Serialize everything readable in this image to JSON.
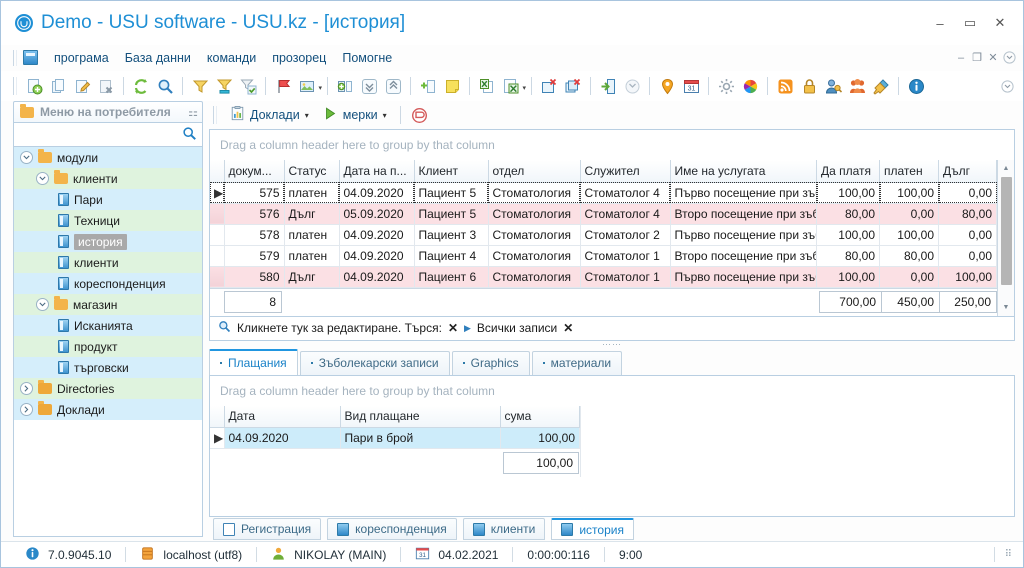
{
  "window": {
    "title": "Demo - USU software - USU.kz - [история]",
    "app_icon": "usu-logo-icon",
    "minimize": "–",
    "maximize": "▭",
    "close": "✕",
    "inner_minimize": "–",
    "inner_restore": "❐",
    "inner_close": "✕"
  },
  "menubar": {
    "items": [
      "програма",
      "База данни",
      "команди",
      "прозорец",
      "Помогне"
    ]
  },
  "toolbar": {
    "groups": [
      [
        "new-record-icon",
        "copy-record-icon",
        "edit-record-icon",
        "delete-record-icon"
      ],
      [
        "refresh-icon",
        "search-icon"
      ],
      [
        "filter-icon",
        "filter-builder-icon",
        "filter-apply-icon"
      ],
      [
        "flag-icon",
        "image-icon"
      ],
      [
        "expand-columns-icon",
        "collapse-all-icon",
        "expand-all-icon"
      ],
      [
        "add-column-icon",
        "note-icon"
      ],
      [
        "export-excel-icon",
        "import-excel-icon"
      ],
      [
        "new-window-icon",
        "close-window-icon"
      ],
      [
        "exit-icon",
        "minimize-window-icon"
      ],
      [
        "map-icon",
        "calendar-icon"
      ],
      [
        "settings-icon",
        "theme-icon"
      ],
      [
        "rss-icon",
        "lock-icon",
        "user-rights-icon",
        "users-icon",
        "plugin-icon"
      ],
      [
        "about-icon"
      ]
    ]
  },
  "sidebar": {
    "header": {
      "label": "Меню на потребителя",
      "folder_icon": "folder-icon",
      "pin_icon": "pin-icon"
    },
    "search": {
      "placeholder": "",
      "value": "",
      "icon": "search-icon"
    },
    "tree": [
      {
        "label": "модули",
        "level": 0,
        "type": "folder",
        "expanded": true,
        "stripe": "blue",
        "selected": false
      },
      {
        "label": "клиенти",
        "level": 1,
        "type": "folder",
        "expanded": true,
        "stripe": "green",
        "selected": false
      },
      {
        "label": "Пари",
        "level": 2,
        "type": "book",
        "expanded": null,
        "stripe": "blue",
        "selected": false
      },
      {
        "label": "Техници",
        "level": 2,
        "type": "book",
        "expanded": null,
        "stripe": "green",
        "selected": false
      },
      {
        "label": "история",
        "level": 2,
        "type": "book",
        "expanded": null,
        "stripe": "blue",
        "selected": true
      },
      {
        "label": "клиенти",
        "level": 2,
        "type": "book",
        "expanded": null,
        "stripe": "green",
        "selected": false
      },
      {
        "label": "кореспонденция",
        "level": 2,
        "type": "book",
        "expanded": null,
        "stripe": "blue",
        "selected": false
      },
      {
        "label": "магазин",
        "level": 1,
        "type": "folder",
        "expanded": true,
        "stripe": "green",
        "selected": false
      },
      {
        "label": "Исканията",
        "level": 2,
        "type": "book",
        "expanded": null,
        "stripe": "blue",
        "selected": false
      },
      {
        "label": "продукт",
        "level": 2,
        "type": "book",
        "expanded": null,
        "stripe": "green",
        "selected": false
      },
      {
        "label": "търговски",
        "level": 2,
        "type": "book",
        "expanded": null,
        "stripe": "blue",
        "selected": false
      },
      {
        "label": "Directories",
        "level": 0,
        "type": "folder",
        "expanded": false,
        "stripe": "green",
        "selected": false
      },
      {
        "label": "Доклади",
        "level": 0,
        "type": "folder",
        "expanded": false,
        "stripe": "blue",
        "selected": false
      }
    ]
  },
  "subtoolbar": {
    "reports": {
      "label": "Доклади",
      "icon": "reports-icon",
      "caret": "▾"
    },
    "measures": {
      "label": "мерки",
      "icon": "play-icon",
      "caret": "▾"
    },
    "stop": {
      "icon": "cancel-icon"
    }
  },
  "main_grid": {
    "group_hint": "Drag a column header here to group by that column",
    "columns": [
      {
        "key": "doc",
        "label": "докум...",
        "align": "right"
      },
      {
        "key": "status",
        "label": "Статус",
        "align": "left"
      },
      {
        "key": "date",
        "label": "Дата на п...",
        "align": "left"
      },
      {
        "key": "client",
        "label": "Клиент",
        "align": "left"
      },
      {
        "key": "dept",
        "label": "отдел",
        "align": "left"
      },
      {
        "key": "employee",
        "label": "Служител",
        "align": "left"
      },
      {
        "key": "service",
        "label": "Име на услугата",
        "align": "left"
      },
      {
        "key": "topay",
        "label": "Да платя",
        "align": "right"
      },
      {
        "key": "paid",
        "label": "платен",
        "align": "right"
      },
      {
        "key": "debt",
        "label": "Дълг",
        "align": "right"
      }
    ],
    "rows": [
      {
        "doc": "575",
        "status": "платен",
        "date": "04.09.2020",
        "client": "Пациент 5",
        "dept": "Стоматология",
        "employee": "Стоматолог 4",
        "service": "Първо посещение при зъболекар",
        "topay": "100,00",
        "paid": "100,00",
        "debt": "0,00",
        "debt_row": false,
        "current": true
      },
      {
        "doc": "576",
        "status": "Дълг",
        "date": "05.09.2020",
        "client": "Пациент 5",
        "dept": "Стоматология",
        "employee": "Стоматолог 4",
        "service": "Второ посещение при зъболекар",
        "topay": "80,00",
        "paid": "0,00",
        "debt": "80,00",
        "debt_row": true,
        "current": false
      },
      {
        "doc": "578",
        "status": "платен",
        "date": "04.09.2020",
        "client": "Пациент 3",
        "dept": "Стоматология",
        "employee": "Стоматолог 2",
        "service": "Първо посещение при зъболекар",
        "topay": "100,00",
        "paid": "100,00",
        "debt": "0,00",
        "debt_row": false,
        "current": false
      },
      {
        "doc": "579",
        "status": "платен",
        "date": "04.09.2020",
        "client": "Пациент 4",
        "dept": "Стоматология",
        "employee": "Стоматолог 1",
        "service": "Второ посещение при зъболекар",
        "topay": "80,00",
        "paid": "80,00",
        "debt": "0,00",
        "debt_row": false,
        "current": false
      },
      {
        "doc": "580",
        "status": "Дълг",
        "date": "04.09.2020",
        "client": "Пациент 6",
        "dept": "Стоматология",
        "employee": "Стоматолог 1",
        "service": "Първо посещение при зъболекар",
        "topay": "100,00",
        "paid": "0,00",
        "debt": "100,00",
        "debt_row": true,
        "current": false
      }
    ],
    "summary": {
      "count": "8",
      "topay_total": "700,00",
      "paid_total": "450,00",
      "debt_total": "250,00"
    }
  },
  "filter_bar": {
    "icon": "search-icon",
    "edit_hint": "Кликнете тук за редактиране. Търся:",
    "clear_left": "✕",
    "play_icon": "▶",
    "preset": "Всички записи",
    "clear_right": "✕"
  },
  "detail_tabs": [
    {
      "label": "Плащания",
      "icon": "window-icon",
      "active": true
    },
    {
      "label": "Зъболекарски записи",
      "icon": "window-icon",
      "active": false
    },
    {
      "label": "Graphics",
      "icon": "window-icon",
      "active": false
    },
    {
      "label": "материали",
      "icon": "window-icon",
      "active": false
    }
  ],
  "detail_grid": {
    "group_hint": "Drag a column header here to group by that column",
    "columns": [
      {
        "key": "date",
        "label": "Дата",
        "align": "left"
      },
      {
        "key": "kind",
        "label": "Вид плащане",
        "align": "left"
      },
      {
        "key": "amount",
        "label": "сума",
        "align": "right"
      }
    ],
    "rows": [
      {
        "date": "04.09.2020",
        "kind": "Пари в брой",
        "amount": "100,00",
        "selected": true
      }
    ],
    "summary": {
      "amount_total": "100,00"
    }
  },
  "bottom_tabs": [
    {
      "label": "Регистрация",
      "icon": "window-icon",
      "active": false
    },
    {
      "label": "кореспонденция",
      "icon": "window-icon",
      "active": false
    },
    {
      "label": "клиенти",
      "icon": "window-icon",
      "active": false
    },
    {
      "label": "история",
      "icon": "window-icon",
      "active": true
    }
  ],
  "statusbar": {
    "version_icon": "info-icon",
    "version": "7.0.9045.10",
    "db_icon": "database-icon",
    "db": "localhost (utf8)",
    "user_icon": "user-icon",
    "user": "NIKOLAY (MAIN)",
    "date_icon": "calendar-icon",
    "date": "04.02.2021",
    "elapsed": "0:00:00:116",
    "time": "9:00",
    "resize_grip": "grip-icon"
  },
  "colors": {
    "accent": "#1e8fd5",
    "title": "#1e8fd5",
    "menu_text": "#14507d",
    "debt_row_bg": "#fbe0e4",
    "selected_row_bg": "#cdecfa",
    "tree_stripe_green": "#dff3de",
    "tree_stripe_blue": "#d5eefb",
    "tree_selected_bg": "#a9a9a9"
  }
}
